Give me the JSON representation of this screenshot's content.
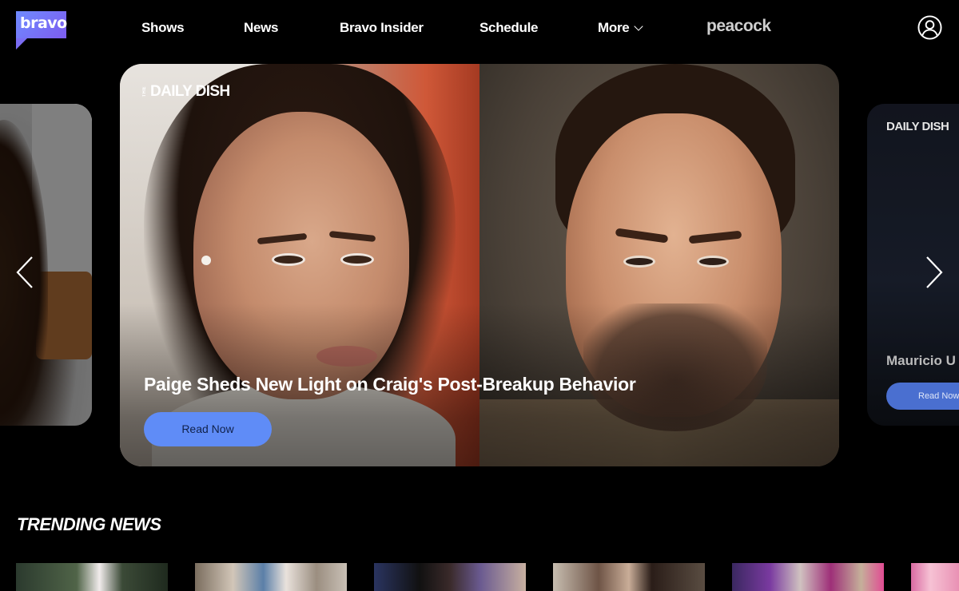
{
  "header": {
    "logo_text": "bravo",
    "nav": [
      {
        "label": "Shows"
      },
      {
        "label": "News"
      },
      {
        "label": "Bravo Insider"
      },
      {
        "label": "Schedule"
      },
      {
        "label": "More"
      }
    ],
    "partner_logo": "peacock",
    "account_icon": "user-circle-icon"
  },
  "carousel": {
    "prev_icon": "chevron-left-icon",
    "next_icon": "chevron-right-icon",
    "hero": {
      "brand_small": "THE",
      "brand": "DAILY DISH",
      "headline": "Paige Sheds New Light on Craig's Post-Breakup Behavior",
      "cta": "Read Now"
    },
    "next_card": {
      "brand": "DAILY DISH",
      "headline": "Mauricio U",
      "cta": "Read Now"
    }
  },
  "trending": {
    "title": "TRENDING NEWS",
    "items": [
      {
        "alt": "trending-thumb-1"
      },
      {
        "alt": "trending-thumb-2"
      },
      {
        "alt": "trending-thumb-3"
      },
      {
        "alt": "trending-thumb-4"
      },
      {
        "alt": "trending-thumb-5"
      },
      {
        "alt": "trending-thumb-6"
      }
    ]
  },
  "colors": {
    "background": "#000000",
    "accent_button": "#5f8cf7",
    "logo_gradient_start": "#6f8bff",
    "logo_gradient_end": "#7d5cf0"
  }
}
